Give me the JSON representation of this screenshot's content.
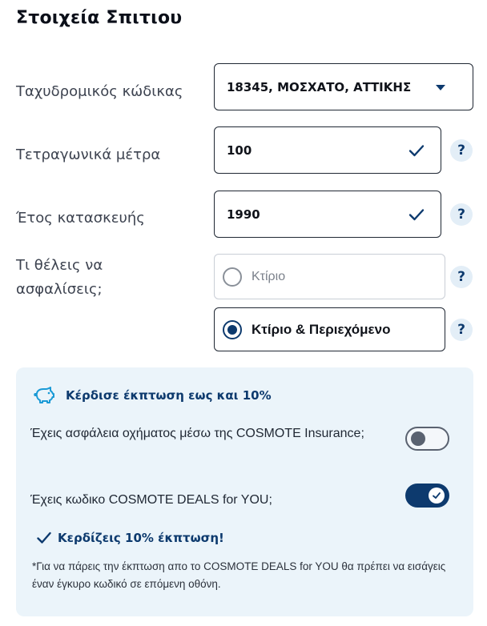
{
  "page": {
    "title": "Στοιχεία Σπιτιου"
  },
  "form": {
    "postal_code": {
      "label": "Ταχυδρομικός κώδικας",
      "value": "18345, ΜΟΣΧΑΤΟ, ΑΤΤΙΚΗΣ"
    },
    "square_meters": {
      "label": "Τετραγωνικά μέτρα",
      "value": "100",
      "help": "?"
    },
    "construction_year": {
      "label": "Έτος κατασκευής",
      "value": "1990",
      "help": "?"
    },
    "insure_what": {
      "label_line1": "Τι θέλεις να",
      "label_line2": "ασφαλίσεις;",
      "options": [
        {
          "label": "Κτίριο",
          "selected": false,
          "help": "?"
        },
        {
          "label": "Κτίριο & Περιεχόμενο",
          "selected": true,
          "help": "?"
        }
      ]
    }
  },
  "discount_panel": {
    "heading": "Κέρδισε έκπτωση εως και 10%",
    "vehicle_insurance": {
      "question": "Έχεις ασφάλεια οχήματος μέσω της COSMOTE Insurance;",
      "enabled": false
    },
    "deals_code": {
      "question": "Έχεις κωδικο COSMOTE DEALS for YOU;",
      "enabled": true
    },
    "success_text": "Κερδίζεις 10% έκπτωση!",
    "footnote": "*Για να πάρεις την έκπτωση απο το COSMOTE DEALS for YOU θα πρέπει να εισάγεις έναν έγκυρο κωδικό σε επόμενη οθόνη."
  },
  "colors": {
    "accent": "#0d3a6e",
    "panel_bg": "#ebf4fa",
    "help_bg": "#e3eef7"
  }
}
